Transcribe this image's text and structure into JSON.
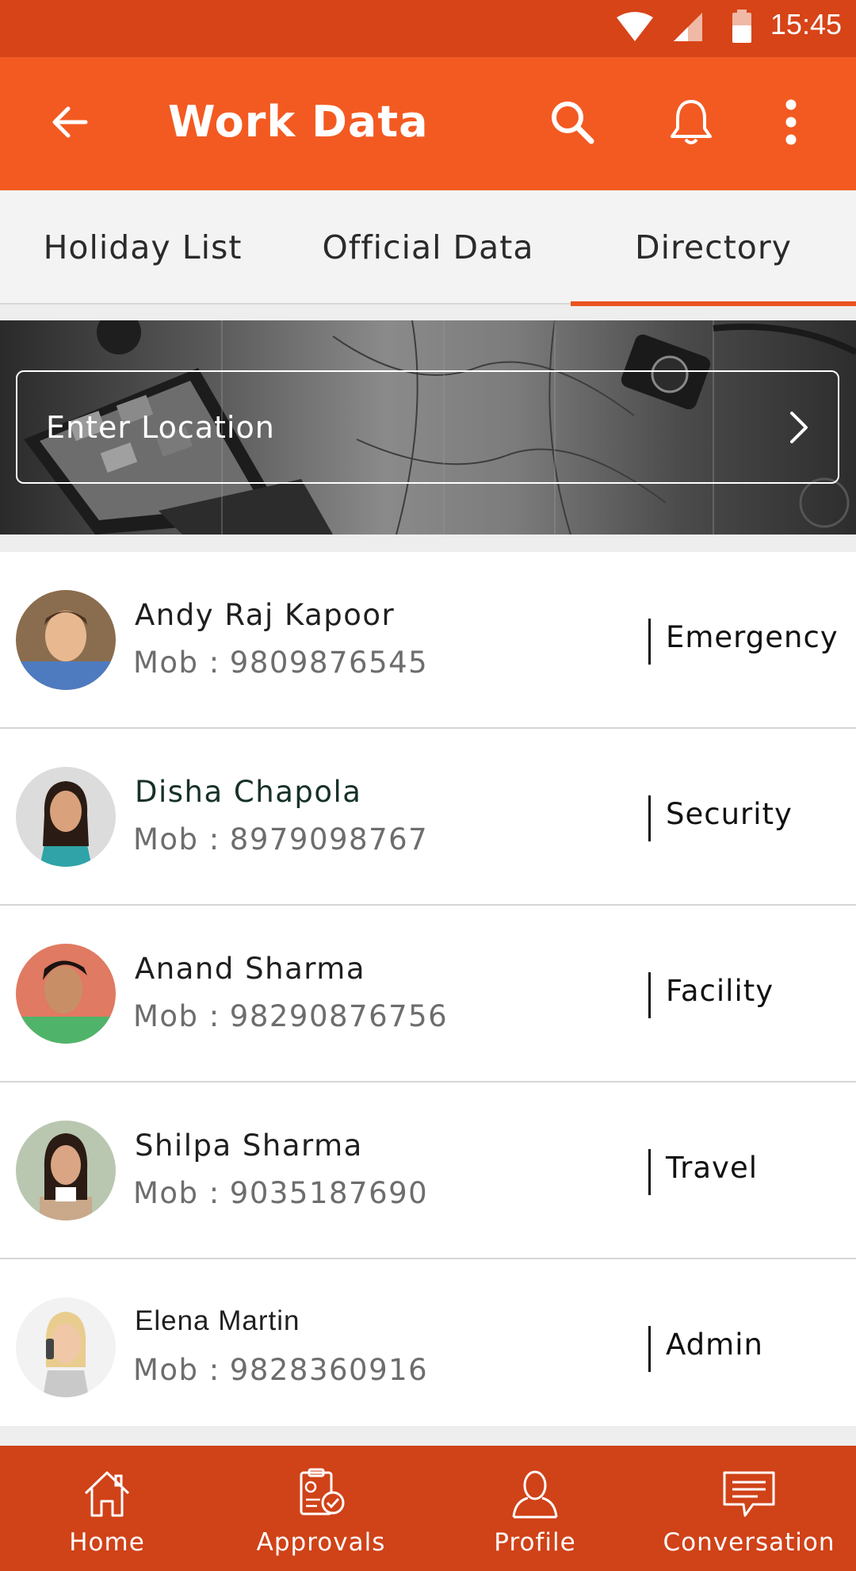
{
  "status_bar": {
    "time": "15:45"
  },
  "app_bar": {
    "title": "Work Data"
  },
  "tabs": [
    {
      "label": "Holiday List",
      "active": false
    },
    {
      "label": "Official Data",
      "active": false
    },
    {
      "label": "Directory",
      "active": true
    }
  ],
  "search": {
    "placeholder": "Enter Location"
  },
  "contacts": [
    {
      "name": "Andy Raj Kapoor",
      "mob_label": "Mob :",
      "mob": "9809876545",
      "department": "Emergency"
    },
    {
      "name": "Disha Chapola",
      "mob_label": "Mob :",
      "mob": "8979098767",
      "department": "Security"
    },
    {
      "name": "Anand Sharma",
      "mob_label": "Mob :",
      "mob": "98290876756",
      "department": "Facility"
    },
    {
      "name": "Shilpa Sharma",
      "mob_label": "Mob :",
      "mob": "9035187690",
      "department": "Travel"
    },
    {
      "name": "Elena Martin",
      "mob_label": "Mob :",
      "mob": "9828360916",
      "department": "Admin"
    }
  ],
  "bottom_nav": [
    {
      "label": "Home",
      "icon": "home-icon"
    },
    {
      "label": "Approvals",
      "icon": "approvals-icon"
    },
    {
      "label": "Profile",
      "icon": "profile-icon"
    },
    {
      "label": "Conversation",
      "icon": "conversation-icon"
    }
  ],
  "colors": {
    "status_bar": "#d74418",
    "app_bar": "#f35a22",
    "tab_indicator": "#ea5320",
    "bottom_nav": "#d04218"
  }
}
